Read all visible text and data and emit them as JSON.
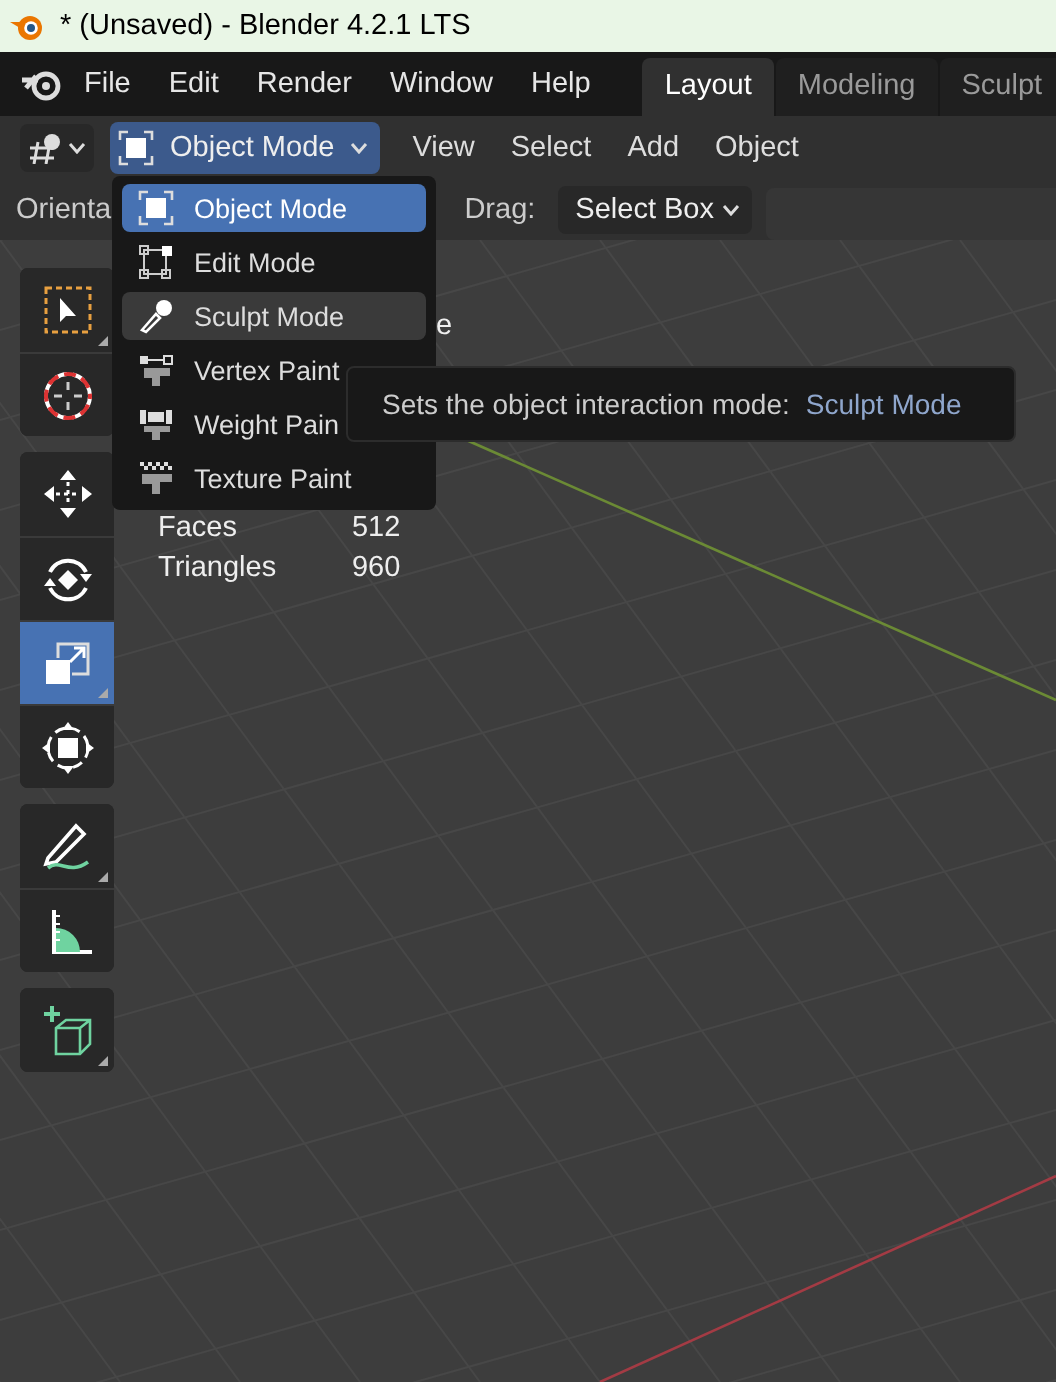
{
  "window": {
    "title": "* (Unsaved) - Blender 4.2.1 LTS"
  },
  "menu_bar": {
    "items": [
      "File",
      "Edit",
      "Render",
      "Window",
      "Help"
    ],
    "workspaces": [
      {
        "label": "Layout",
        "selected": true
      },
      {
        "label": "Modeling",
        "selected": false
      },
      {
        "label": "Sculpt",
        "selected": false
      }
    ]
  },
  "header": {
    "mode": "Object Mode",
    "menus": [
      "View",
      "Select",
      "Add",
      "Object"
    ]
  },
  "tool_settings": {
    "orientation_label": "Orienta",
    "drag_label": "Drag:",
    "drag_value": "Select Box"
  },
  "mode_menu": {
    "items": [
      {
        "kind": "object",
        "label": "Object Mode",
        "selected": true,
        "hovered": false
      },
      {
        "kind": "edit",
        "label": "Edit Mode",
        "selected": false,
        "hovered": false
      },
      {
        "kind": "sculpt",
        "label": "Sculpt Mode",
        "selected": false,
        "hovered": true
      },
      {
        "kind": "vertex",
        "label": "Vertex Paint",
        "selected": false,
        "hovered": false
      },
      {
        "kind": "weight",
        "label": "Weight Pain",
        "selected": false,
        "hovered": false
      },
      {
        "kind": "texture",
        "label": "Texture Paint",
        "selected": false,
        "hovered": false
      }
    ]
  },
  "tooltip": {
    "text": "Sets the object interaction mode:",
    "value": "Sculpt Mode"
  },
  "viewport_text": "e",
  "stats": [
    {
      "label": "Faces",
      "value": "512"
    },
    {
      "label": "Triangles",
      "value": "960"
    }
  ],
  "toolbar": {
    "groups": [
      [
        {
          "kind": "select",
          "selected": false
        },
        {
          "kind": "cursor",
          "selected": false
        }
      ],
      [
        {
          "kind": "move",
          "selected": false
        },
        {
          "kind": "rotate",
          "selected": false
        },
        {
          "kind": "scale",
          "selected": true
        },
        {
          "kind": "transform",
          "selected": false
        }
      ],
      [
        {
          "kind": "annotate",
          "selected": false
        },
        {
          "kind": "measure",
          "selected": false
        }
      ],
      [
        {
          "kind": "add-cube",
          "selected": false
        }
      ]
    ]
  }
}
